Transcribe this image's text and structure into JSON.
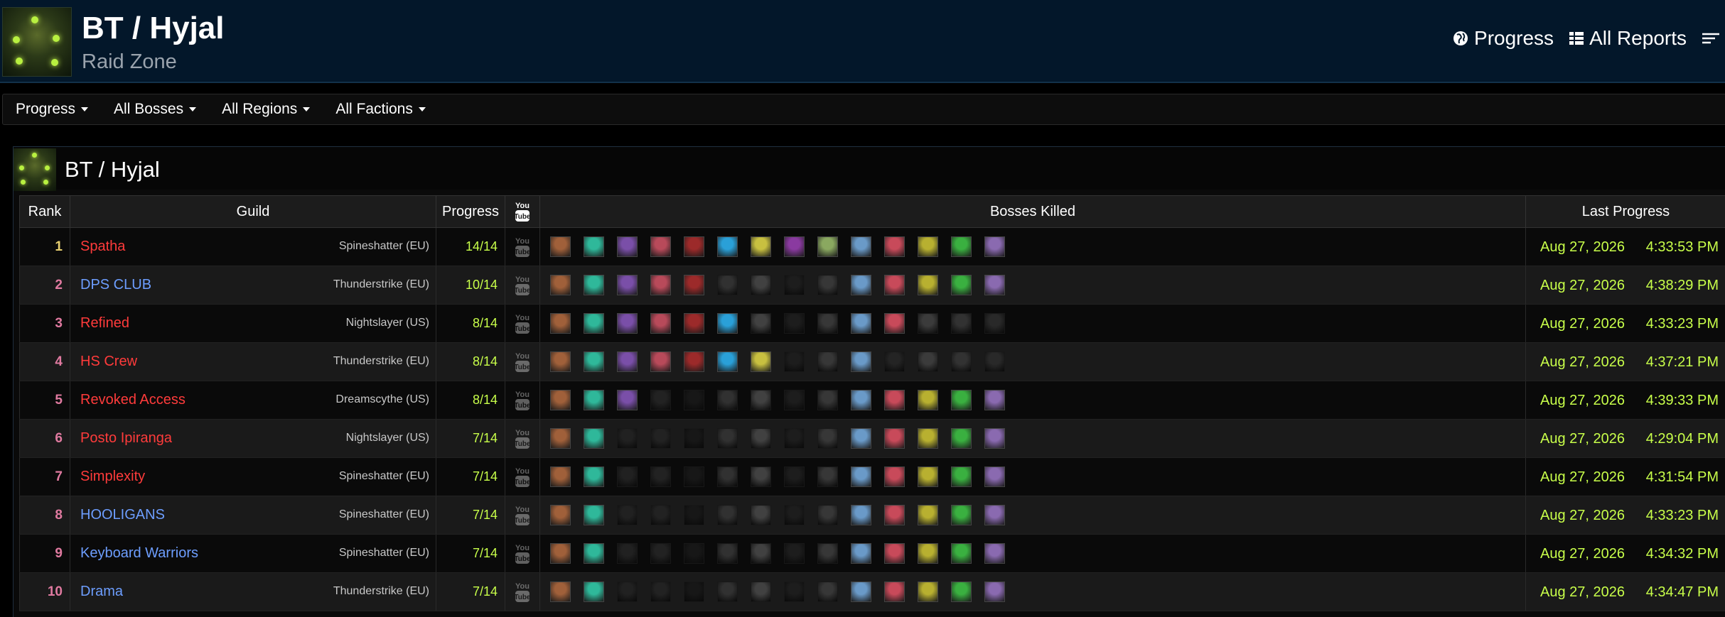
{
  "header": {
    "title": "BT / Hyjal",
    "subtitle": "Raid Zone",
    "links": [
      "Progress",
      "All Reports"
    ],
    "icons": [
      "globe-icon",
      "table-icon",
      "menu-icon"
    ]
  },
  "filters": [
    "Progress",
    "All Bosses",
    "All Regions",
    "All Factions"
  ],
  "panel": {
    "title": "BT / Hyjal"
  },
  "table": {
    "headers": {
      "rank": "Rank",
      "guild": "Guild",
      "progress": "Progress",
      "bosses": "Bosses Killed",
      "last": "Last Progress"
    },
    "boss_colors": [
      "#a0603a",
      "#2fb89a",
      "#7a4fa8",
      "#b84a5a",
      "#9c2a2a",
      "#2aa0d8",
      "#c8c040",
      "#8a3aa0",
      "#8aa860",
      "#6a9ac8",
      "#c84a5a",
      "#b8b030",
      "#3ab040",
      "#8a6ab0"
    ],
    "rows": [
      {
        "rank": "1",
        "name": "Spatha",
        "server": "Spineshatter (EU)",
        "progress": "14/14",
        "kills": [
          1,
          1,
          1,
          1,
          1,
          1,
          1,
          1,
          1,
          1,
          1,
          1,
          1,
          1
        ],
        "date": "Aug 27, 2026",
        "time": "4:33:53 PM",
        "name_color": "#ff3b3b",
        "rank_color": "#e8d070"
      },
      {
        "rank": "2",
        "name": "DPS CLUB",
        "server": "Thunderstrike (EU)",
        "progress": "10/14",
        "kills": [
          1,
          1,
          1,
          1,
          1,
          0,
          0,
          0,
          0,
          1,
          1,
          1,
          1,
          1
        ],
        "date": "Aug 27, 2026",
        "time": "4:38:29 PM",
        "name_color": "#6d9eff",
        "rank_color": "#e07aa0"
      },
      {
        "rank": "3",
        "name": "Refined",
        "server": "Nightslayer (US)",
        "progress": "8/14",
        "kills": [
          1,
          1,
          1,
          1,
          1,
          1,
          0,
          0,
          0,
          1,
          1,
          0,
          0,
          0
        ],
        "date": "Aug 27, 2026",
        "time": "4:33:23 PM",
        "name_color": "#ff3b3b",
        "rank_color": "#e07aa0"
      },
      {
        "rank": "4",
        "name": "HS Crew",
        "server": "Thunderstrike (EU)",
        "progress": "8/14",
        "kills": [
          1,
          1,
          1,
          1,
          1,
          1,
          1,
          0,
          0,
          1,
          0,
          0,
          0,
          0
        ],
        "date": "Aug 27, 2026",
        "time": "4:37:21 PM",
        "name_color": "#ff3b3b",
        "rank_color": "#e07aa0"
      },
      {
        "rank": "5",
        "name": "Revoked Access",
        "server": "Dreamscythe (US)",
        "progress": "8/14",
        "kills": [
          1,
          1,
          1,
          0,
          0,
          0,
          0,
          0,
          0,
          1,
          1,
          1,
          1,
          1
        ],
        "date": "Aug 27, 2026",
        "time": "4:39:33 PM",
        "name_color": "#ff3b3b",
        "rank_color": "#e07aa0"
      },
      {
        "rank": "6",
        "name": "Posto Ipiranga",
        "server": "Nightslayer (US)",
        "progress": "7/14",
        "kills": [
          1,
          1,
          0,
          0,
          0,
          0,
          0,
          0,
          0,
          1,
          1,
          1,
          1,
          1
        ],
        "date": "Aug 27, 2026",
        "time": "4:29:04 PM",
        "name_color": "#ff3b3b",
        "rank_color": "#e07aa0"
      },
      {
        "rank": "7",
        "name": "Simplexity",
        "server": "Spineshatter (EU)",
        "progress": "7/14",
        "kills": [
          1,
          1,
          0,
          0,
          0,
          0,
          0,
          0,
          0,
          1,
          1,
          1,
          1,
          1
        ],
        "date": "Aug 27, 2026",
        "time": "4:31:54 PM",
        "name_color": "#ff3b3b",
        "rank_color": "#e07aa0"
      },
      {
        "rank": "8",
        "name": "HOOLIGANS",
        "server": "Spineshatter (EU)",
        "progress": "7/14",
        "kills": [
          1,
          1,
          0,
          0,
          0,
          0,
          0,
          0,
          0,
          1,
          1,
          1,
          1,
          1
        ],
        "date": "Aug 27, 2026",
        "time": "4:33:23 PM",
        "name_color": "#6d9eff",
        "rank_color": "#e07aa0"
      },
      {
        "rank": "9",
        "name": "Keyboard Warriors",
        "server": "Spineshatter (EU)",
        "progress": "7/14",
        "kills": [
          1,
          1,
          0,
          0,
          0,
          0,
          0,
          0,
          0,
          1,
          1,
          1,
          1,
          1
        ],
        "date": "Aug 27, 2026",
        "time": "4:34:32 PM",
        "name_color": "#6d9eff",
        "rank_color": "#e07aa0"
      },
      {
        "rank": "10",
        "name": "Drama",
        "server": "Thunderstrike (EU)",
        "progress": "7/14",
        "kills": [
          1,
          1,
          0,
          0,
          0,
          0,
          0,
          0,
          0,
          1,
          1,
          1,
          1,
          1
        ],
        "date": "Aug 27, 2026",
        "time": "4:34:47 PM",
        "name_color": "#6d9eff",
        "rank_color": "#e07aa0"
      }
    ]
  }
}
